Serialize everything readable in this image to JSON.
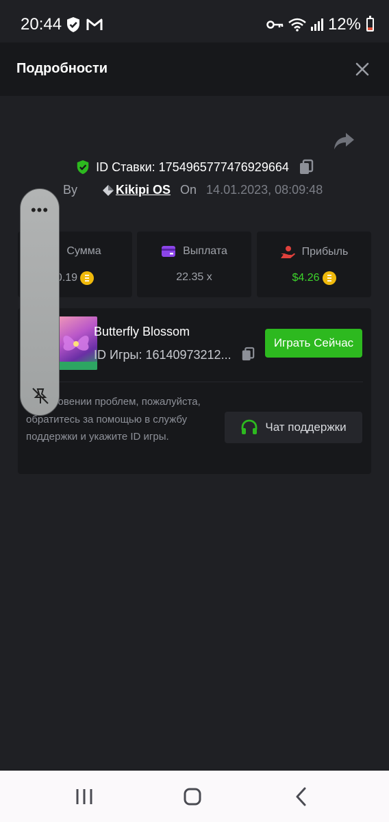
{
  "status_bar": {
    "time": "20:44",
    "battery": "12%",
    "icons": [
      "shield-check-icon",
      "gmail-icon",
      "key-icon",
      "wifi-icon",
      "signal-icon",
      "battery-icon"
    ]
  },
  "header": {
    "title": "Подробности",
    "close_icon": "close-icon"
  },
  "bet": {
    "id_text": "ID Ставки: 1754965777476929664",
    "by_label": "By",
    "username": "Kikipi OS",
    "on_label": "On",
    "date": "14.01.2023, 08:09:48"
  },
  "stats": [
    {
      "label": "Сумма",
      "value": "0.19",
      "icon": "heart-icon",
      "has_coin": true
    },
    {
      "label": "Выплата",
      "value": "22.35 x",
      "icon": "card-icon",
      "has_coin": false
    },
    {
      "label": "Прибыль",
      "value": "$4.26",
      "icon": "hand-coin-icon",
      "has_coin": true
    }
  ],
  "game": {
    "name": "Butterfly Blossom",
    "id_text": "ID Игры: 16140973212...",
    "play_label": "Играть Сейчас",
    "help_text": "озникновении проблем, пожалуйста, обратитесь за помощью в службу поддержки и укажите ID игры.",
    "support_label": "Чат поддержки"
  },
  "colors": {
    "background": "#1f2024",
    "card": "#17181b",
    "accent_green": "#2db91f",
    "profit_green": "#3dd32b",
    "coin": "#f0b90b"
  }
}
